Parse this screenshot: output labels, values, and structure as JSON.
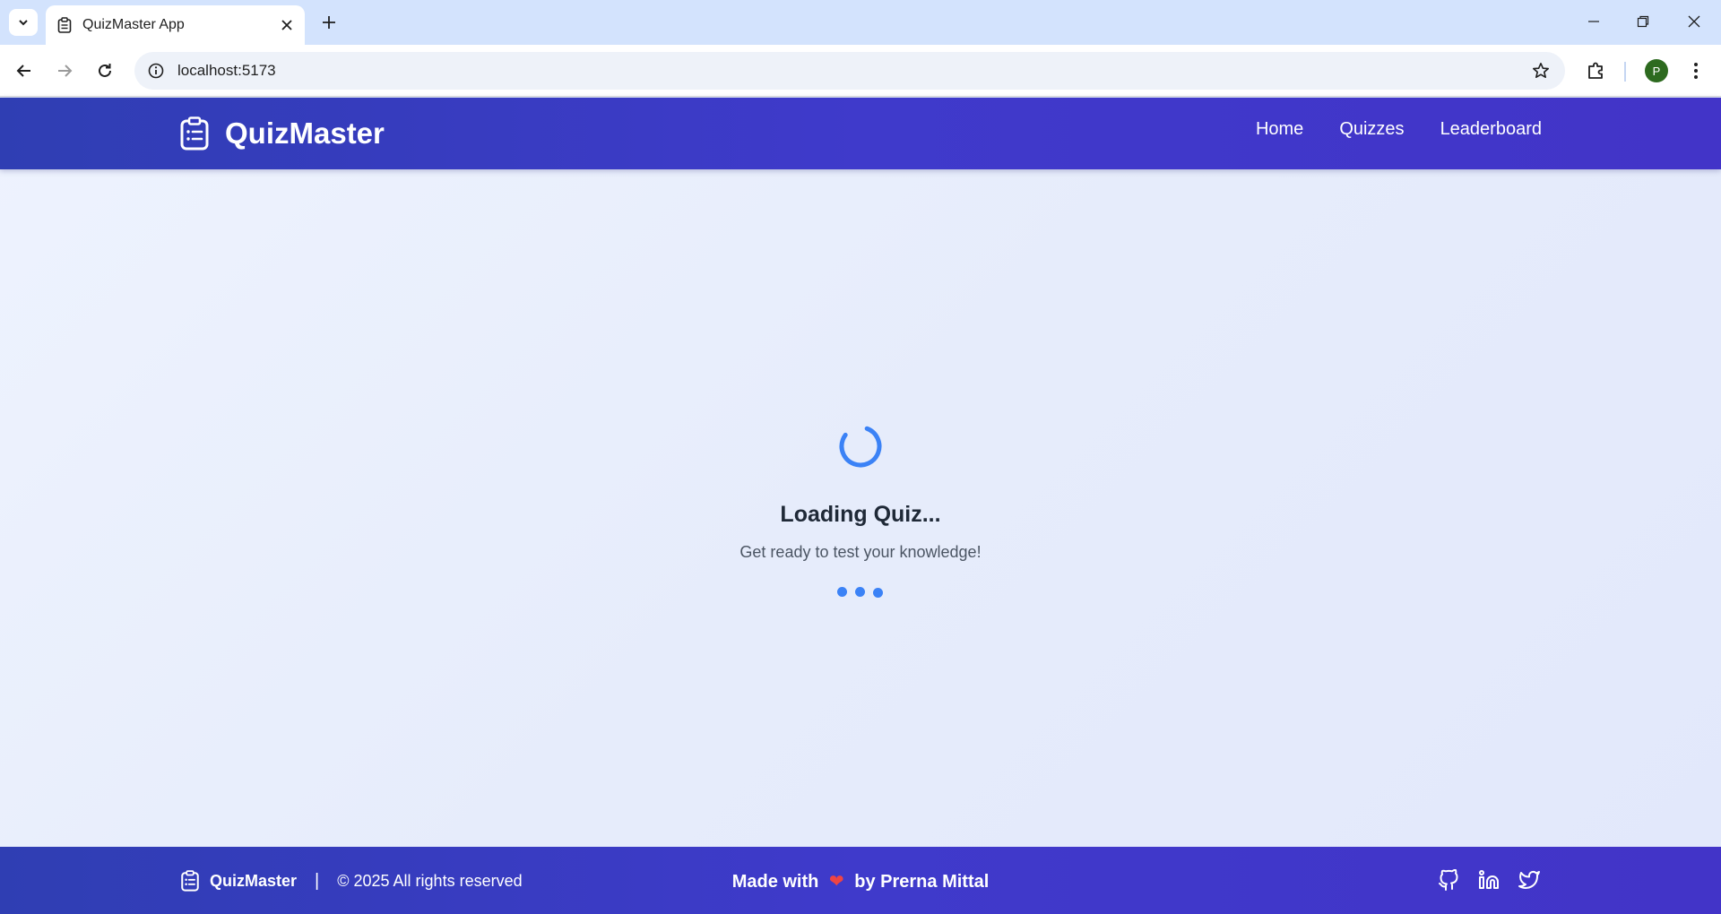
{
  "browser": {
    "tab_title": "QuizMaster App",
    "url": "localhost:5173",
    "profile_initial": "P"
  },
  "app": {
    "brand": "QuizMaster",
    "nav": [
      {
        "label": "Home"
      },
      {
        "label": "Quizzes"
      },
      {
        "label": "Leaderboard"
      }
    ],
    "loading": {
      "title": "Loading Quiz...",
      "subtitle": "Get ready to test your knowledge!"
    },
    "footer": {
      "brand": "QuizMaster",
      "separator": "|",
      "copyright": "© 2025 All rights reserved",
      "made_with_prefix": "Made with",
      "heart": "❤",
      "made_with_suffix": "by Prerna Mittal",
      "social": [
        "github-icon",
        "linkedin-icon",
        "twitter-icon"
      ]
    }
  },
  "colors": {
    "nav_gradient_start": "#2f3eb3",
    "nav_gradient_end": "#4234c8",
    "accent_blue": "#3b82f6",
    "heart_red": "#ef4444",
    "page_background": "#eef3fe"
  }
}
